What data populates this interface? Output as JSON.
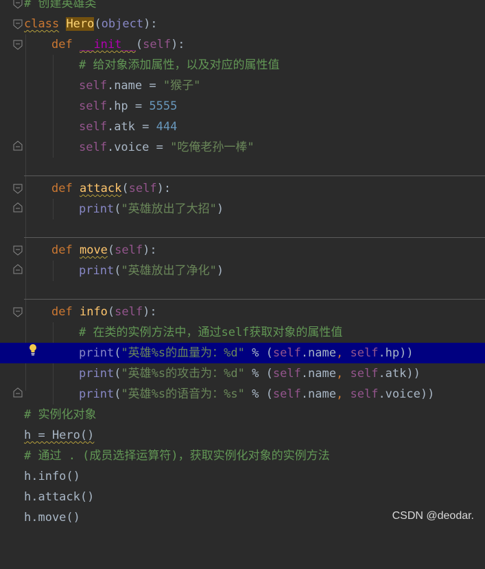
{
  "editor": {
    "lines": [
      {
        "comment": "# 创建英雄类"
      },
      {
        "kw": "class",
        "name": "Hero",
        "base": "object"
      },
      {
        "kw": "def",
        "fn": "__init__",
        "param": "self"
      },
      {
        "comment": "# 给对象添加属性，以及对应的属性值"
      },
      {
        "self": "self",
        "attr": ".name",
        "op": " = ",
        "value": "\"猴子\""
      },
      {
        "self": "self",
        "attr": ".hp",
        "op": " = ",
        "value": "5555"
      },
      {
        "self": "self",
        "attr": ".atk",
        "op": " = ",
        "value": "444"
      },
      {
        "self": "self",
        "attr": ".voice",
        "op": " = ",
        "value": "\"吃俺老孙一棒\""
      },
      {
        "kw": "def",
        "fn": "attack",
        "param": "self"
      },
      {
        "builtin": "print",
        "arg": "\"英雄放出了大招\""
      },
      {
        "kw": "def",
        "fn": "move",
        "param": "self"
      },
      {
        "builtin": "print",
        "arg": "\"英雄放出了净化\""
      },
      {
        "kw": "def",
        "fn": "info",
        "param": "self"
      },
      {
        "comment": "# 在类的实例方法中，通过self获取对象的属性值"
      },
      {
        "builtin": "print",
        "fmt_a": "\"英雄",
        "fmt_spec": "%s",
        "fmt_b": "的血量为：",
        "fmt_spec2": "%d",
        "fmt_c": "\"",
        "attr": ".hp"
      },
      {
        "builtin": "print",
        "fmt_a": "\"英雄",
        "fmt_spec": "%s",
        "fmt_b": "的攻击为：",
        "fmt_spec2": "%d",
        "fmt_c": "\"",
        "attr": ".atk"
      },
      {
        "builtin": "print",
        "fmt_a": "\"英雄",
        "fmt_spec": "%s",
        "fmt_b": "的语音为：",
        "fmt_spec2": "%s",
        "fmt_c": "\"",
        "attr": ".voice"
      },
      {
        "comment": "# 实例化对象"
      },
      {
        "text": "h = Hero()"
      },
      {
        "comment": "# 通过 . (成员选择运算符)，获取实例化对象的实例方法"
      },
      {
        "text": "h.info()"
      },
      {
        "text": "h.attack()"
      },
      {
        "text": "h.move()"
      }
    ],
    "percent_op": " % (",
    "self_kw": "self",
    "name_attr": ".name",
    "comma": ", ",
    "close": "))"
  },
  "watermark": "CSDN @deodar.",
  "colors": {
    "background": "#2b2b2b",
    "keyword": "#cc7832",
    "function": "#ffc66d",
    "self": "#94558d",
    "string": "#6a8759",
    "number": "#6897bb",
    "comment": "#629755",
    "highlight_line": "#000080"
  }
}
